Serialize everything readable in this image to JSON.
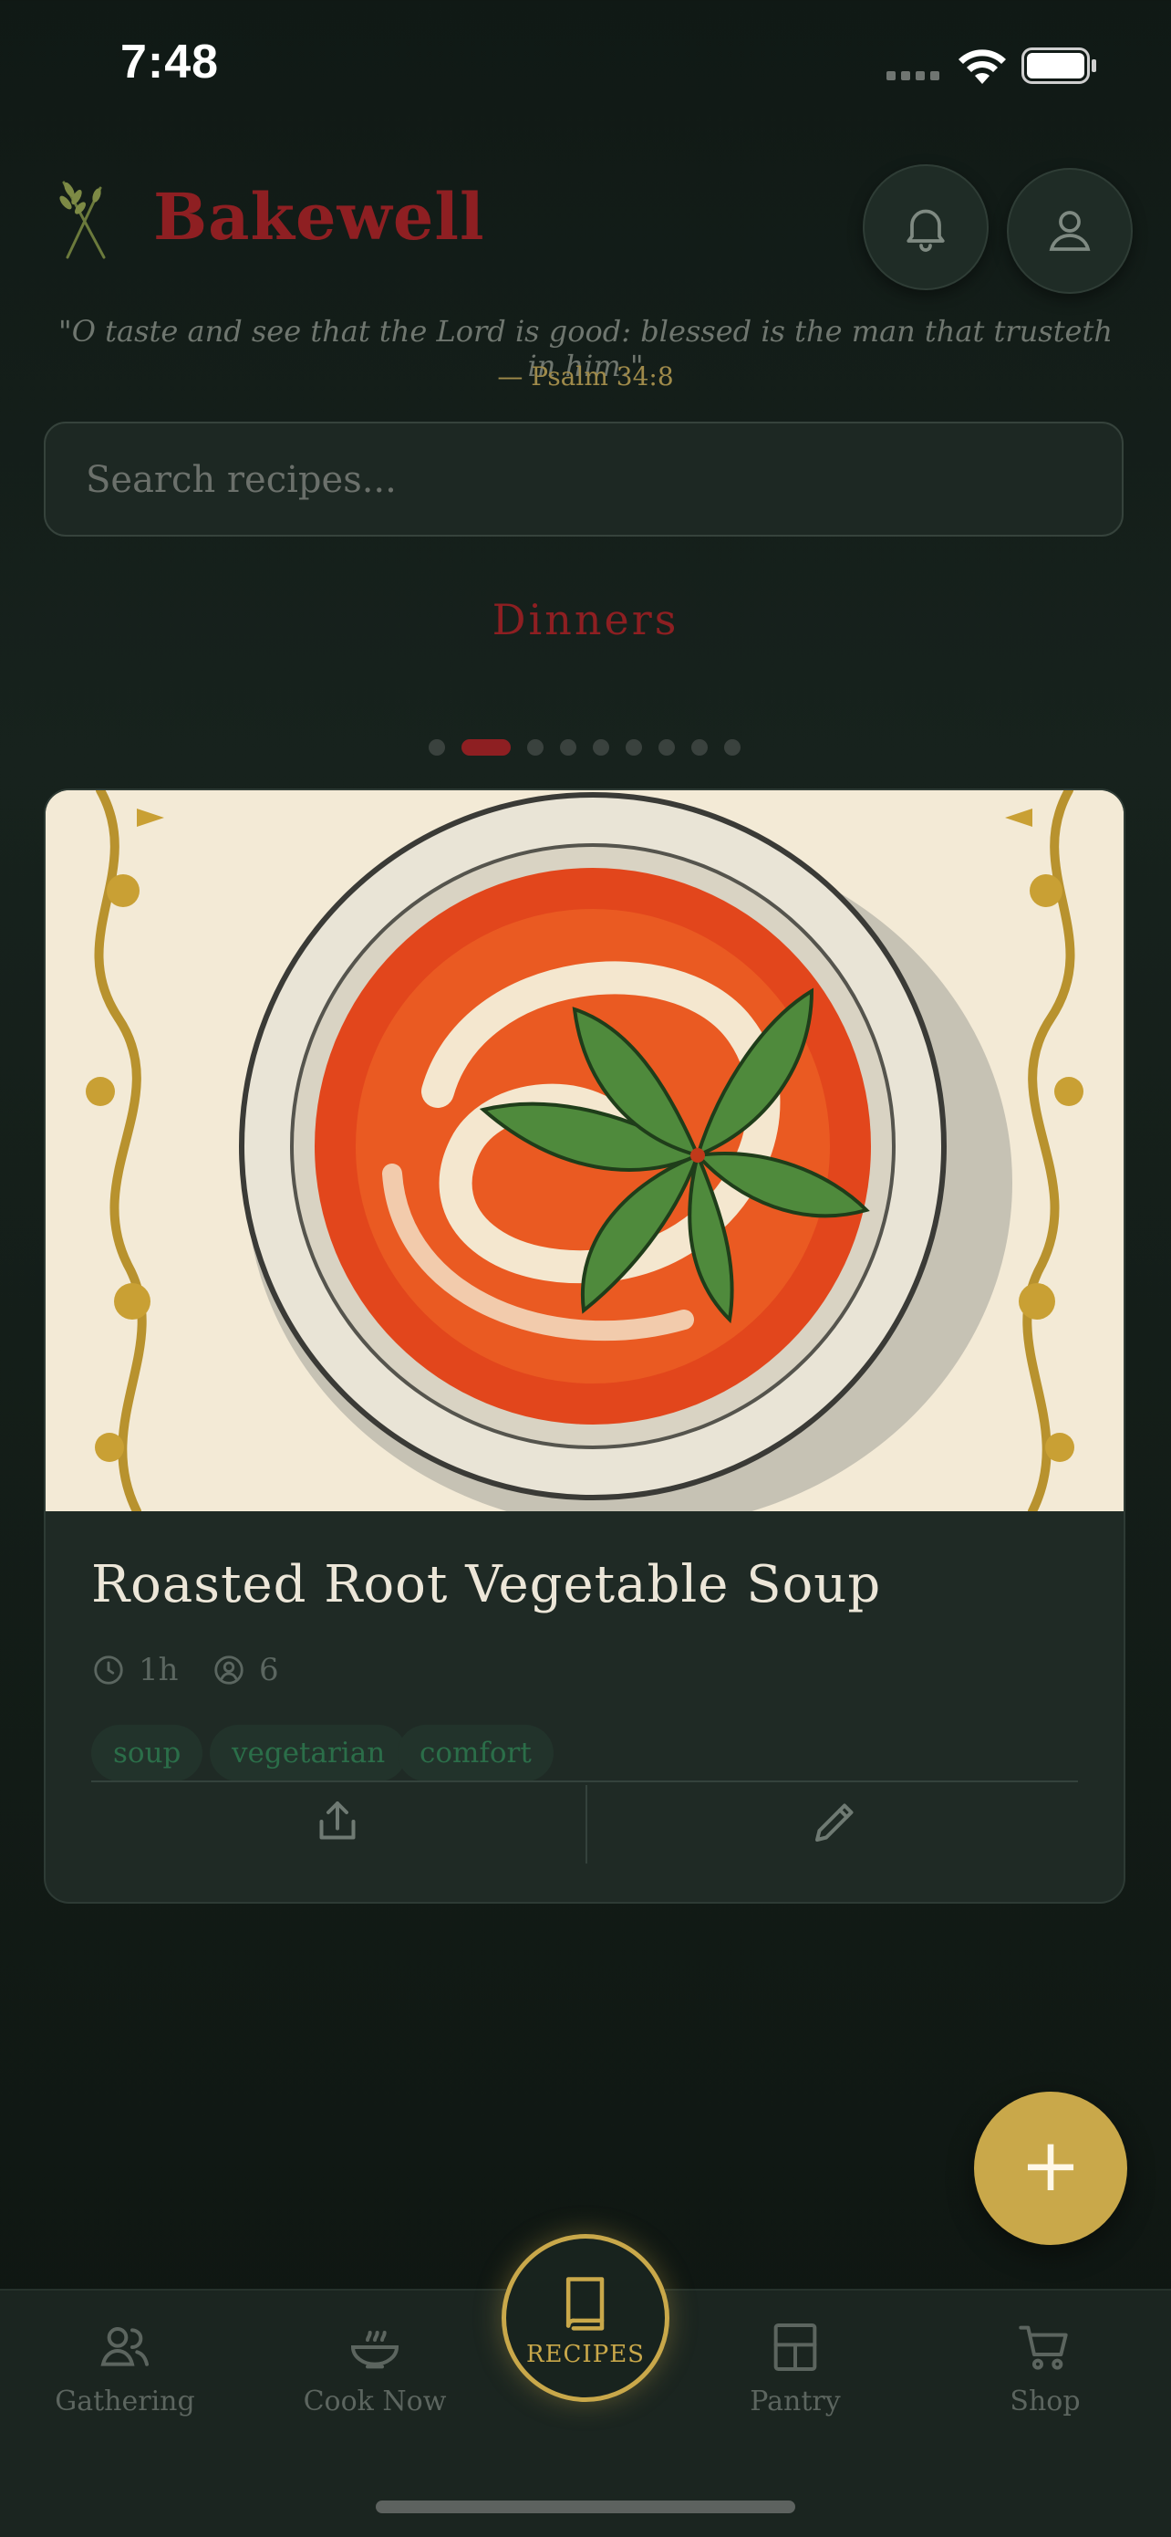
{
  "status_bar": {
    "time": "7:48"
  },
  "header": {
    "brand": "Bakewell",
    "verse": "\"O taste and see that the Lord is good: blessed is the man that trusteth in him.\"",
    "verse_ref": "— Psalm 34:8"
  },
  "search": {
    "placeholder": "Search recipes..."
  },
  "section": {
    "title": "Dinners",
    "carousel_pages": 10,
    "active_page": 2
  },
  "card": {
    "title": "Roasted Root Vegetable Soup",
    "time": "1h",
    "servings": "6",
    "tags": [
      "soup",
      "vegetarian",
      "comfort"
    ]
  },
  "tabs": [
    {
      "label": "Gathering",
      "icon": "people-icon"
    },
    {
      "label": "Cook Now",
      "icon": "bowl-icon"
    },
    {
      "label": "RECIPES",
      "icon": "book-icon",
      "active": true
    },
    {
      "label": "Pantry",
      "icon": "pantry-icon"
    },
    {
      "label": "Shop",
      "icon": "cart-icon"
    }
  ],
  "colors": {
    "accent_red": "#8e1f22",
    "accent_gold": "#c9a84a",
    "tag_green": "#2b6e49",
    "background": "#141d18"
  }
}
